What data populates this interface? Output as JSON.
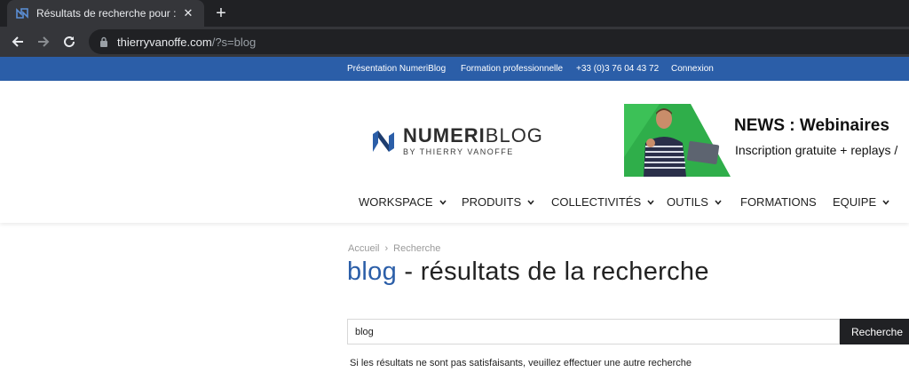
{
  "browser": {
    "tab_title": "Résultats de recherche pour : blog",
    "close_glyph": "✕",
    "new_tab_glyph": "+",
    "url_host": "thierryvanoffe.com",
    "url_path": "/?s=blog"
  },
  "topbar": {
    "links": [
      "Présentation NumeriBlog",
      "Formation professionnelle",
      "+33 (0)3 76 04 43 72",
      "Connexion"
    ],
    "bg_color": "#2b5ea8"
  },
  "logo": {
    "name_bold": "NUMERI",
    "name_light": "BLOG",
    "tagline": "BY THIERRY VANOFFE"
  },
  "banner": {
    "title": "NEWS : Webinaires",
    "subtitle": "Inscription gratuite + replays /"
  },
  "nav": {
    "items": [
      {
        "label": "WORKSPACE",
        "dropdown": true
      },
      {
        "label": "PRODUITS",
        "dropdown": true
      },
      {
        "label": "COLLECTIVITÉS",
        "dropdown": true
      },
      {
        "label": "OUTILS",
        "dropdown": true
      },
      {
        "label": "FORMATIONS",
        "dropdown": false
      },
      {
        "label": "EQUIPE",
        "dropdown": true
      }
    ]
  },
  "breadcrumb": {
    "home": "Accueil",
    "separator": "›",
    "current": "Recherche"
  },
  "results": {
    "keyword": "blog",
    "title_suffix": " - résultats de la recherche",
    "search_value": "blog",
    "search_button": "Recherche",
    "hint": "Si les résultats ne sont pas satisfaisants, veuillez effectuer une autre recherche"
  }
}
